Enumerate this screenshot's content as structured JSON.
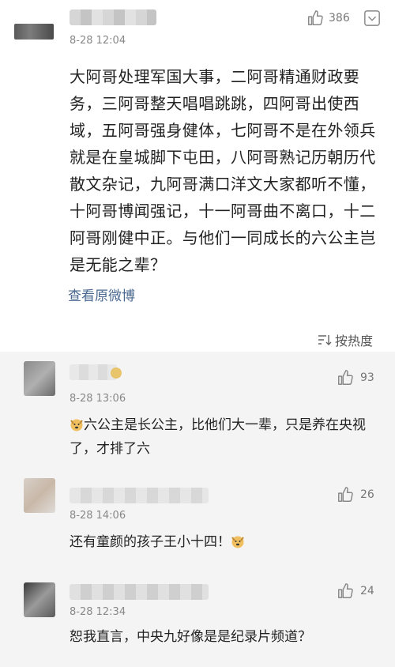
{
  "main_post": {
    "time": "8-28 12:04",
    "like_count": "386",
    "text": "大阿哥处理军国大事，二阿哥精通财政要务，三阿哥整天唱唱跳跳，四阿哥出使西域，五阿哥强身健体，七阿哥不是在外领兵就是在皇城脚下屯田，八阿哥熟记历朝历代散文杂记，九阿哥满口洋文大家都听不懂，十阿哥博闻强记，十一阿哥曲不离口，十二阿哥刚健中正。与他们一同成长的六公主岂是无能之辈？",
    "view_original": "查看原微博",
    "sort_label": "按热度"
  },
  "replies": [
    {
      "time": "8-28 13:06",
      "like_count": "93",
      "text": "六公主是长公主，比他们大一辈，只是养在央视了，才排了六"
    },
    {
      "time": "8-28 14:06",
      "like_count": "26",
      "text": "还有童颜的孩子王小十四！"
    },
    {
      "time": "8-28 12:34",
      "like_count": "24",
      "text": "恕我直言，中央九好像是是纪录片频道？"
    }
  ],
  "colors": {
    "link": "#4a6890",
    "reply_bg": "#f4f4f4",
    "meta": "#888888"
  }
}
